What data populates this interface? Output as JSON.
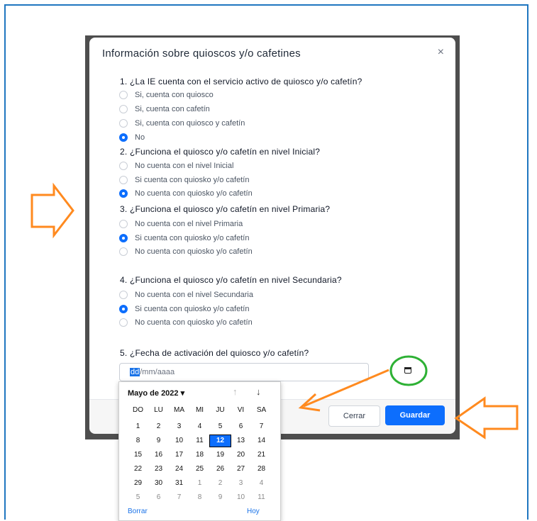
{
  "modal": {
    "title": "Información sobre quioscos y/o cafetines",
    "close_label": "×"
  },
  "questions": [
    {
      "label": "1. ¿La IE cuenta con el servicio activo de quiosco y/o cafetín?",
      "options": [
        {
          "label": "Si, cuenta con quiosco",
          "selected": false
        },
        {
          "label": "Si, cuenta con cafetín",
          "selected": false
        },
        {
          "label": "Si, cuenta con quiosco y cafetín",
          "selected": false
        },
        {
          "label": "No",
          "selected": true
        }
      ]
    },
    {
      "label": "2. ¿Funciona el quiosco y/o cafetín en nivel Inicial?",
      "options": [
        {
          "label": "No cuenta con el nivel Inicial",
          "selected": false
        },
        {
          "label": "Si cuenta con quiosko y/o cafetín",
          "selected": false
        },
        {
          "label": "No cuenta con quiosko y/o cafetín",
          "selected": true
        }
      ]
    },
    {
      "label": "3. ¿Funciona el quiosco y/o cafetín en nivel Primaria?",
      "options": [
        {
          "label": "No cuenta con el nivel Primaria",
          "selected": false
        },
        {
          "label": "Si cuenta con quiosko y/o cafetín",
          "selected": true
        },
        {
          "label": "No cuenta con quiosko y/o cafetín",
          "selected": false
        }
      ]
    },
    {
      "label": "4. ¿Funciona el quiosco y/o cafetín en nivel Secundaria?",
      "options": [
        {
          "label": "No cuenta con el nivel Secundaria",
          "selected": false
        },
        {
          "label": "Si cuenta con quiosko y/o cafetín",
          "selected": true
        },
        {
          "label": "No cuenta con quiosko y/o cafetín",
          "selected": false
        }
      ]
    },
    {
      "label": "5. ¿Fecha de activación del quiosco y/o cafetín?"
    }
  ],
  "date_field": {
    "segment_dd": "dd",
    "rest": "/mm/aaaa"
  },
  "buttons": {
    "cerrar": "Cerrar",
    "guardar": "Guardar"
  },
  "datepicker": {
    "month_label": "Mayo de 2022 ▾",
    "up_arrow": "↑",
    "down_arrow": "↓",
    "weekdays": [
      "DO",
      "LU",
      "MA",
      "MI",
      "JU",
      "VI",
      "SA"
    ],
    "weeks": [
      [
        "1",
        "2",
        "3",
        "4",
        "5",
        "6",
        "7"
      ],
      [
        "8",
        "9",
        "10",
        "11",
        "12",
        "13",
        "14"
      ],
      [
        "15",
        "16",
        "17",
        "18",
        "19",
        "20",
        "21"
      ],
      [
        "22",
        "23",
        "24",
        "25",
        "26",
        "27",
        "28"
      ],
      [
        "29",
        "30",
        "31",
        "1",
        "2",
        "3",
        "4"
      ],
      [
        "5",
        "6",
        "7",
        "8",
        "9",
        "10",
        "11"
      ]
    ],
    "selected_day": "12",
    "borrar_label": "Borrar",
    "hoy_label": "Hoy"
  },
  "colors": {
    "accent": "#0d6efd",
    "annotation_arrow": "#ff8a1f",
    "annotation_circle": "#2eb135",
    "frame_border": "#1f76c0"
  }
}
